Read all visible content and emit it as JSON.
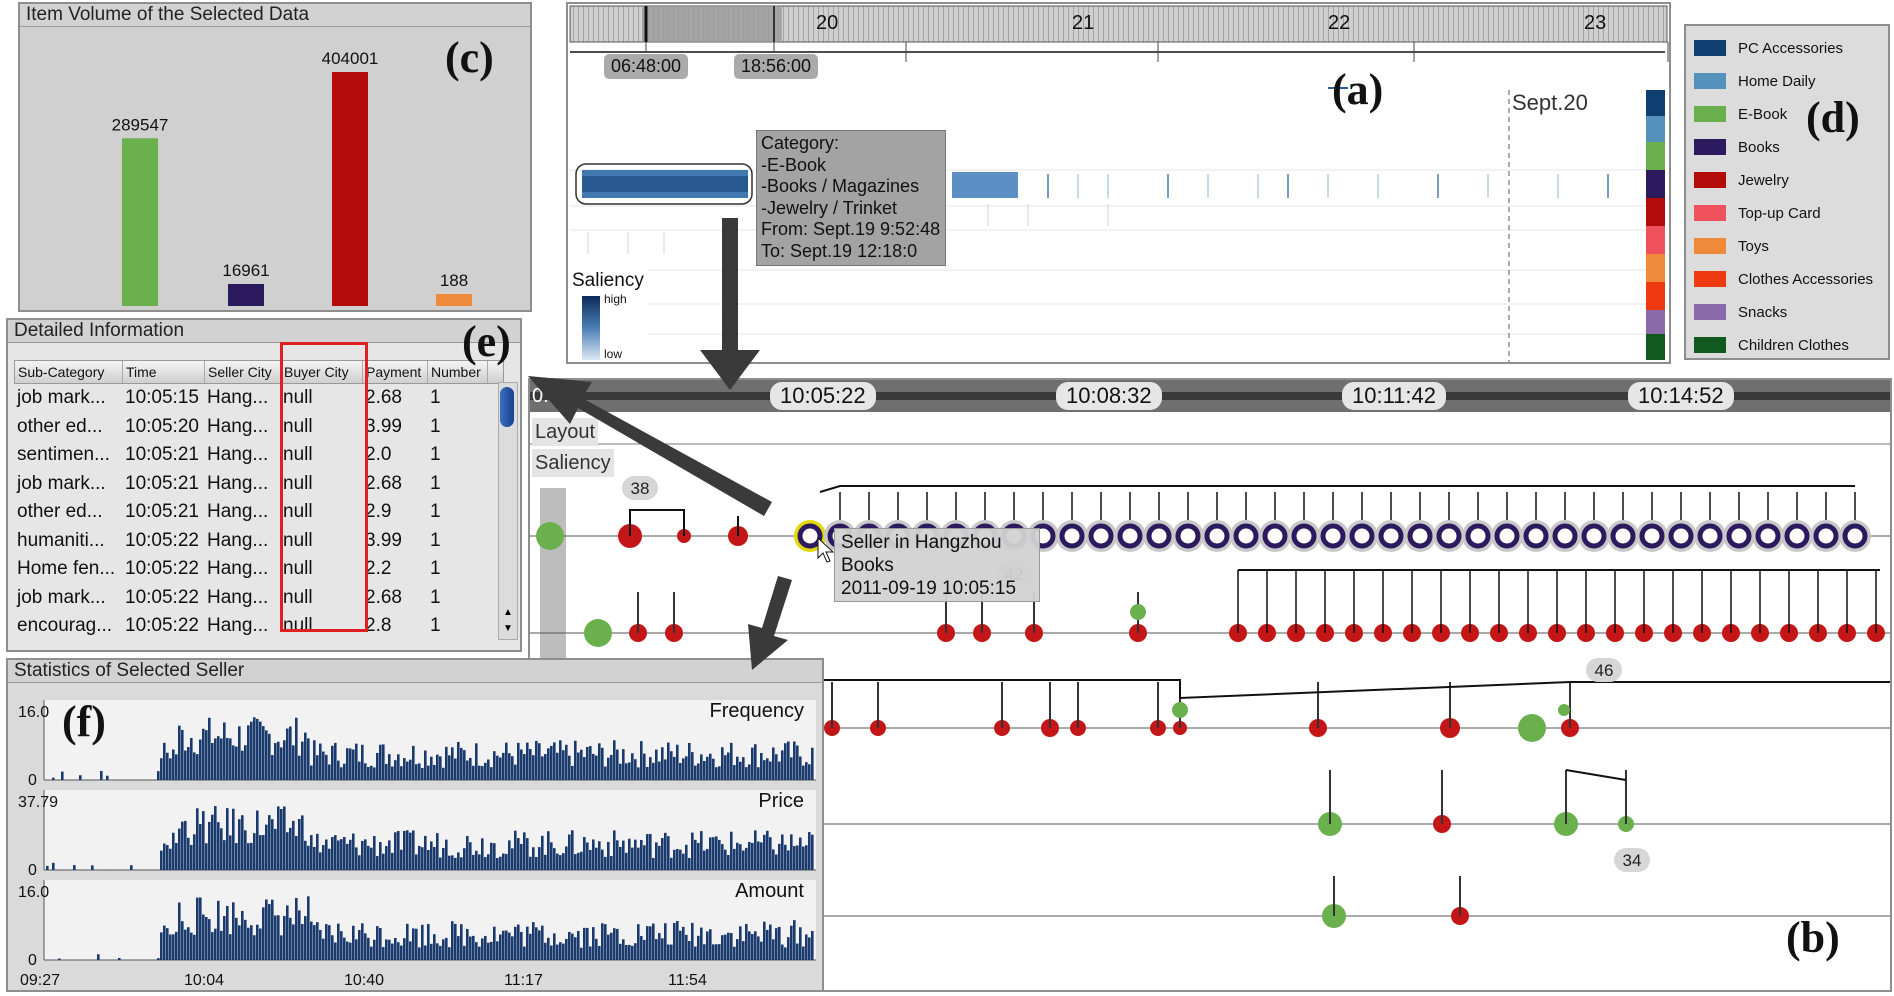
{
  "labels": {
    "a": "(a)",
    "b": "(b)",
    "c": "(c)",
    "d": "(d)",
    "e": "(e)",
    "f": "(f)"
  },
  "item_volume": {
    "title": "Item Volume of the Selected Data",
    "bars": [
      {
        "value": 289547,
        "label": "289547",
        "color": "#6ab04c"
      },
      {
        "value": 16961,
        "label": "16961",
        "color": "#2b1a5e"
      },
      {
        "value": 404001,
        "label": "404001",
        "color": "#b30a0a"
      },
      {
        "value": 188,
        "label": "188",
        "color": "#ee8a3a"
      }
    ]
  },
  "timeline": {
    "day_ticks": [
      "20",
      "21",
      "22",
      "23"
    ],
    "range_start": "06:48:00",
    "range_end": "18:56:00",
    "sept_label": "Sept.20",
    "saliency_title": "Saliency",
    "saliency_high": "high",
    "saliency_low": "low",
    "tooltip": {
      "header": "Category:",
      "line1": "-E-Book",
      "line2": "-Books / Magazines",
      "line3": "-Jewelry / Trinket",
      "line4": "From: Sept.19 9:52:48",
      "line5": "To: Sept.19 12:18:0"
    }
  },
  "legend": {
    "items": [
      {
        "label": "PC Accessories",
        "color": "#0f3f70"
      },
      {
        "label": "Home Daily",
        "color": "#5492bb"
      },
      {
        "label": "E-Book",
        "color": "#6ab04c"
      },
      {
        "label": "Books",
        "color": "#2b1a5e"
      },
      {
        "label": "Jewelry",
        "color": "#b30a0a"
      },
      {
        "label": "Top-up Card",
        "color": "#f0525d"
      },
      {
        "label": "Toys",
        "color": "#ee8a3a"
      },
      {
        "label": "Clothes Accessories",
        "color": "#ee3a10"
      },
      {
        "label": "Snacks",
        "color": "#8a6aaa"
      },
      {
        "label": "Children Clothes",
        "color": "#12591f"
      }
    ]
  },
  "detail": {
    "title": "Detailed Information",
    "columns": [
      "Sub-Category",
      "Time",
      "Seller City",
      "Buyer City",
      "Payment",
      "Number"
    ],
    "rows": [
      [
        "job mark...",
        "10:05:15",
        "Hang...",
        "null",
        "2.68",
        "1"
      ],
      [
        "other ed...",
        "10:05:20",
        "Hang...",
        "null",
        "3.99",
        "1"
      ],
      [
        "sentimen...",
        "10:05:21",
        "Hang...",
        "null",
        "2.0",
        "1"
      ],
      [
        "job mark...",
        "10:05:21",
        "Hang...",
        "null",
        "2.68",
        "1"
      ],
      [
        "other ed...",
        "10:05:21",
        "Hang...",
        "null",
        "2.9",
        "1"
      ],
      [
        "humaniti...",
        "10:05:22",
        "Hang...",
        "null",
        "3.99",
        "1"
      ],
      [
        "Home fen...",
        "10:05:22",
        "Hang...",
        "null",
        "2.2",
        "1"
      ],
      [
        "job mark...",
        "10:05:22",
        "Hang...",
        "null",
        "2.68",
        "1"
      ],
      [
        "encourag...",
        "10:05:22",
        "Hang...",
        "null",
        "2.8",
        "1"
      ]
    ]
  },
  "transactions": {
    "axis_start": "0:",
    "time_ticks": [
      "10:05:22",
      "10:08:32",
      "10:11:42",
      "10:14:52"
    ],
    "layout_button": "Layout",
    "saliency_button": "Saliency",
    "badges": [
      "38",
      "42",
      "46",
      "34"
    ],
    "tooltip": {
      "line1": "Seller in Hangzhou",
      "line2": "Books",
      "line3": "2011-09-19 10:05:15"
    }
  },
  "seller_stats": {
    "title": "Statistics of Selected Seller",
    "charts": [
      {
        "label": "Frequency",
        "ymax": "16.0",
        "ymin": "0"
      },
      {
        "label": "Price",
        "ymax": "37.79",
        "ymin": "0"
      },
      {
        "label": "Amount",
        "ymax": "16.0",
        "ymin": "0"
      }
    ],
    "x_ticks": [
      "09:27",
      "10:04",
      "10:40",
      "11:17",
      "11:54"
    ]
  }
}
